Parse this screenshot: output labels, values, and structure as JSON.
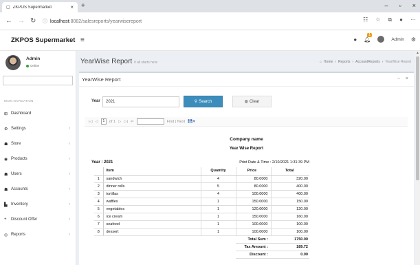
{
  "browser": {
    "tab_title": "ZKPOS Supermarket",
    "url_host": "localhost",
    "url_path": ":8082/salesreports/yearwisereport"
  },
  "app": {
    "brand": "ZKPOS Supermarket",
    "notification_count": "1",
    "admin_label": "Admin"
  },
  "sidebar": {
    "user_name": "Admin",
    "user_status": "Online",
    "main_nav_label": "MAIN NAVIGATION",
    "items": [
      {
        "label": "Dashboard",
        "icon": "dashboard-icon"
      },
      {
        "label": "Settings",
        "icon": "gear-icon"
      },
      {
        "label": "Store",
        "icon": "users-icon"
      },
      {
        "label": "Products",
        "icon": "products-icon"
      },
      {
        "label": "Users",
        "icon": "users-icon"
      },
      {
        "label": "Accounts",
        "icon": "users-icon"
      },
      {
        "label": "Inventory",
        "icon": "chart-icon"
      },
      {
        "label": "Discount Offer",
        "icon": "plus-icon"
      },
      {
        "label": "Reports",
        "icon": "eye-icon"
      }
    ]
  },
  "page": {
    "title": "YearWise Report",
    "subtitle": "it all starts here",
    "breadcrumb": [
      "Home",
      "Reports",
      "AccountReports",
      "YearWise Report"
    ]
  },
  "box": {
    "title": "YearWise Report"
  },
  "filter": {
    "year_label": "Year",
    "year_value": "2021",
    "search_label": "Search",
    "clear_label": "Clear"
  },
  "viewer_toolbar": {
    "page_input": "1",
    "page_of": "of 1",
    "find_label": "Find | Next"
  },
  "report": {
    "company": "Company name",
    "name": "Year Wise Report",
    "year_line": "Year : 2021",
    "print_date": "Print Date & Time : 2/10/2021 1:31:39 PM",
    "columns": [
      "",
      "Item",
      "Quantity",
      "Price",
      "Total"
    ],
    "rows": [
      {
        "no": "1",
        "item": "sandwich",
        "qty": "4",
        "price": "80.0000",
        "total": "320.00"
      },
      {
        "no": "2",
        "item": "dinner rolls",
        "qty": "5",
        "price": "80.0000",
        "total": "400.00"
      },
      {
        "no": "3",
        "item": "tortillas",
        "qty": "4",
        "price": "100.0000",
        "total": "400.00"
      },
      {
        "no": "4",
        "item": "waffles",
        "qty": "1",
        "price": "150.0000",
        "total": "150.00"
      },
      {
        "no": "5",
        "item": "vegetables",
        "qty": "1",
        "price": "120.0000",
        "total": "120.00"
      },
      {
        "no": "6",
        "item": "ice cream",
        "qty": "1",
        "price": "150.0000",
        "total": "160.00"
      },
      {
        "no": "7",
        "item": "seafood",
        "qty": "1",
        "price": "100.0000",
        "total": "100.00"
      },
      {
        "no": "8",
        "item": "dessert",
        "qty": "1",
        "price": "100.0000",
        "total": "100.00"
      }
    ],
    "summary": [
      {
        "label": "Total Sum :",
        "value": "1750.00"
      },
      {
        "label": "Tax Amount :",
        "value": "189.72"
      },
      {
        "label": "Discount :",
        "value": "0.00"
      }
    ]
  }
}
